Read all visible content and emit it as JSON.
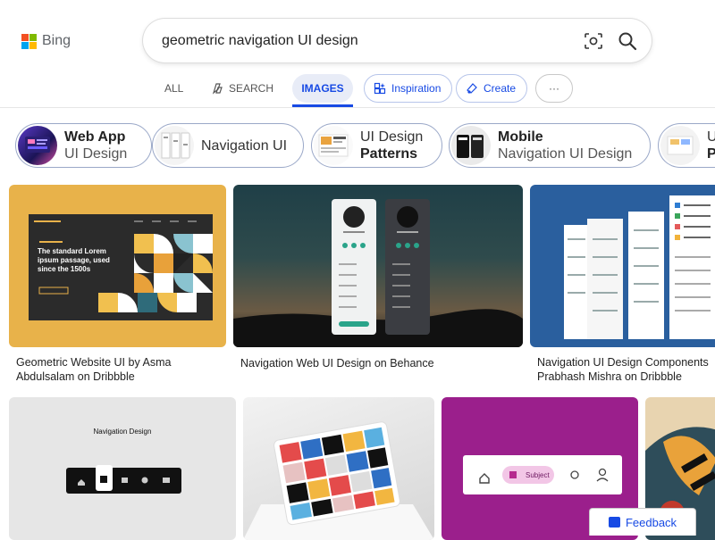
{
  "brand": {
    "name": "Bing",
    "colors": [
      "#f25022",
      "#7fba00",
      "#00a4ef",
      "#ffb900"
    ]
  },
  "search": {
    "query": "geometric navigation UI design",
    "visual_search_icon": "camera-lens-icon",
    "search_icon": "magnifier-icon"
  },
  "tabs": [
    {
      "label": "ALL"
    },
    {
      "label": "SEARCH",
      "icon": "copilot-icon"
    },
    {
      "label": "IMAGES",
      "active": true
    },
    {
      "label": "Inspiration",
      "icon": "sparkle-grid-icon"
    },
    {
      "label": "Create",
      "icon": "paint-icon"
    },
    {
      "label": "···"
    }
  ],
  "chips": [
    {
      "line1": "Web App",
      "line2": "UI Design"
    },
    {
      "line1": "Navigation UI"
    },
    {
      "line1": "UI Design",
      "line2": "Patterns"
    },
    {
      "line1": "Mobile",
      "line2": "Navigation UI Design"
    },
    {
      "line1": "U",
      "line2": "P"
    }
  ],
  "results": [
    {
      "caption1": "Geometric Website UI by Asma",
      "caption2": "Abdulsalam on Dribbble",
      "inner_title": "The standard Lorem ipsum passage, used since the 1500s"
    },
    {
      "caption1": "Navigation Web UI Design on Behance"
    },
    {
      "caption1": "Navigation UI Design Components",
      "caption2": "Prabhash Mishra on Dribbble"
    },
    {
      "inner_title": "Navigation Design"
    },
    {},
    {
      "inner_label": "Subject"
    },
    {}
  ],
  "feedback": {
    "label": "Feedback"
  },
  "accent": "#174ae4"
}
